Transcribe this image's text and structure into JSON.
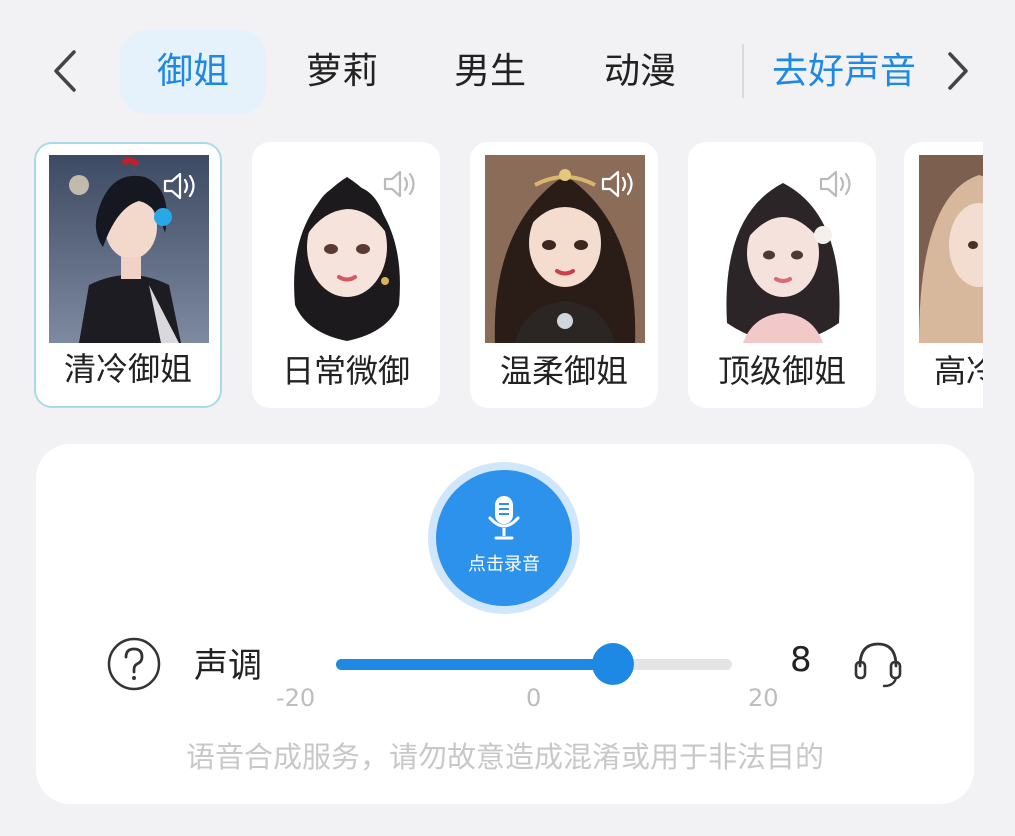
{
  "tabs": [
    {
      "label": "御姐",
      "active": true
    },
    {
      "label": "萝莉",
      "active": false
    },
    {
      "label": "男生",
      "active": false
    },
    {
      "label": "动漫",
      "active": false
    }
  ],
  "tab_link": "去好声音",
  "voices": [
    {
      "name": "清冷御姐",
      "selected": true
    },
    {
      "name": "日常微御",
      "selected": false
    },
    {
      "name": "温柔御姐",
      "selected": false
    },
    {
      "name": "顶级御姐",
      "selected": false
    },
    {
      "name": "高冷",
      "selected": false
    }
  ],
  "record": {
    "label": "点击录音"
  },
  "pitch": {
    "label": "声调",
    "value": "8",
    "min": -20,
    "max": 20,
    "ticks": [
      "-20",
      "0",
      "20"
    ]
  },
  "disclaimer": "语音合成服务，请勿故意造成混淆或用于非法目的",
  "colors": {
    "accent": "#1e88e5",
    "active_tab_bg": "#e5f1fb",
    "selected_border": "#a9dbe6"
  },
  "icons": [
    "chevron-left-icon",
    "chevron-right-icon",
    "speaker-icon",
    "microphone-icon",
    "help-icon",
    "headphone-icon"
  ]
}
